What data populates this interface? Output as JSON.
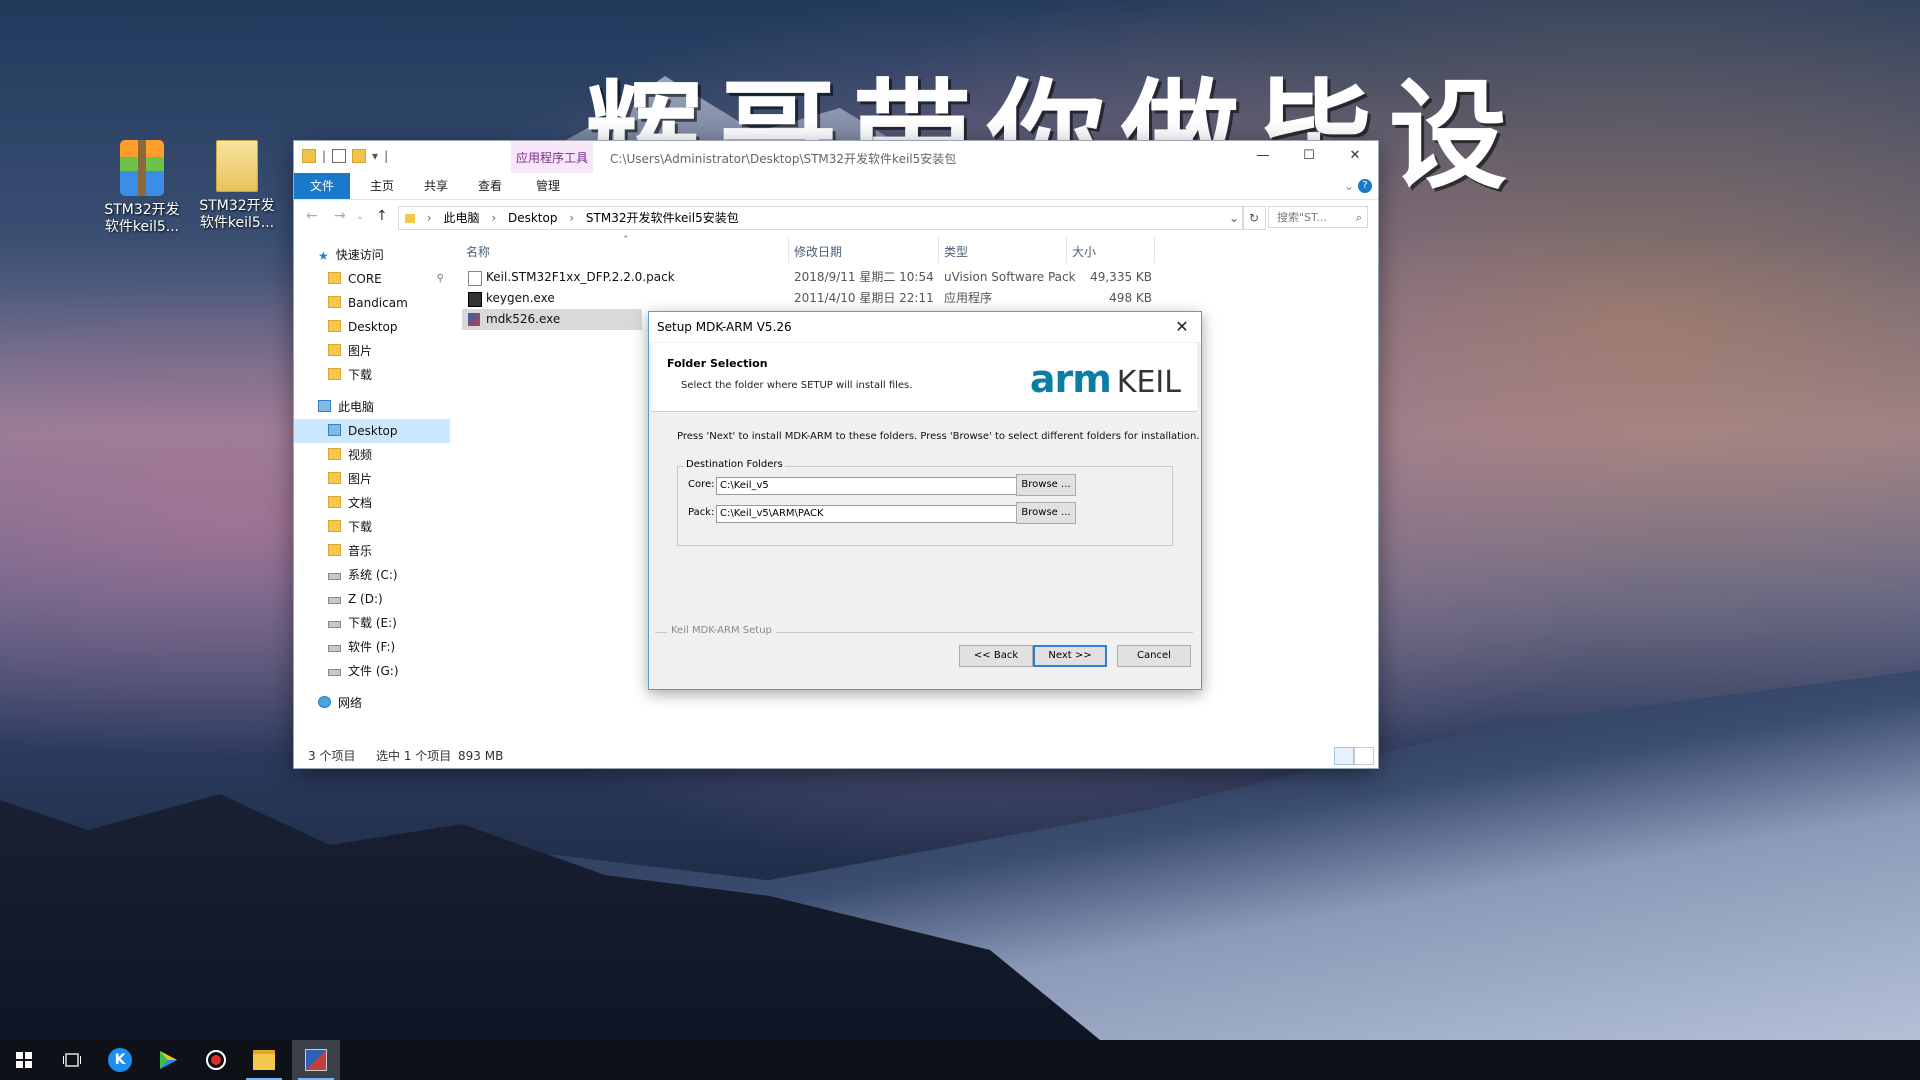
{
  "watermark": "辉哥带你做毕设",
  "desktop_icons": [
    {
      "label_line1": "STM32开发",
      "label_line2": "软件keil5...",
      "icon": "winrar-archive-icon"
    },
    {
      "label_line1": "STM32开发",
      "label_line2": "软件keil5...",
      "icon": "folder-icon"
    }
  ],
  "explorer": {
    "context_tab": "应用程序工具",
    "title_path": "C:\\Users\\Administrator\\Desktop\\STM32开发软件keil5安装包",
    "ribbon_tabs": [
      "文件",
      "主页",
      "共享",
      "查看",
      "管理"
    ],
    "breadcrumb": [
      "此电脑",
      "Desktop",
      "STM32开发软件keil5安装包"
    ],
    "search_placeholder": "搜索\"ST...",
    "nav": {
      "quick_access": "快速访问",
      "quick_items": [
        "CORE",
        "Bandicam",
        "Desktop",
        "图片",
        "下载"
      ],
      "this_pc": "此电脑",
      "pc_items": [
        "Desktop",
        "视频",
        "图片",
        "文档",
        "下载",
        "音乐",
        "系统 (C:)",
        "Z (D:)",
        "下载 (E:)",
        "软件 (F:)",
        "文件 (G:)"
      ],
      "network": "网络"
    },
    "columns": [
      "名称",
      "修改日期",
      "类型",
      "大小"
    ],
    "files": [
      {
        "name": "Keil.STM32F1xx_DFP.2.2.0.pack",
        "date": "2018/9/11 星期二 10:54",
        "type": "uVision Software Pack",
        "size": "49,335 KB"
      },
      {
        "name": "keygen.exe",
        "date": "2011/4/10 星期日 22:11",
        "type": "应用程序",
        "size": "498 KB"
      },
      {
        "name": "mdk526.exe",
        "date": "",
        "type": "",
        "size": ""
      }
    ],
    "status": {
      "count": "3 个项目",
      "selected": "选中 1 个项目",
      "size": "893 MB"
    }
  },
  "setup": {
    "title": "Setup MDK-ARM V5.26",
    "header_title": "Folder Selection",
    "header_sub": "Select the folder where SETUP will install files.",
    "logo_arm": "arm",
    "logo_keil": "KEIL",
    "description": "Press 'Next' to install MDK-ARM to these folders. Press 'Browse' to select different folders for installation.",
    "group_label": "Destination Folders",
    "core_label": "Core:",
    "core_value": "C:\\Keil_v5",
    "pack_label": "Pack:",
    "pack_value": "C:\\Keil_v5\\ARM\\PACK",
    "browse": "Browse ...",
    "footer_label": "Keil MDK-ARM Setup",
    "back": "<< Back",
    "next": "Next >>",
    "cancel": "Cancel"
  },
  "taskbar": [
    "start-icon",
    "task-view-icon",
    "kugou-icon",
    "media-player-icon",
    "record-icon",
    "file-explorer-icon",
    "mdk-setup-icon"
  ]
}
